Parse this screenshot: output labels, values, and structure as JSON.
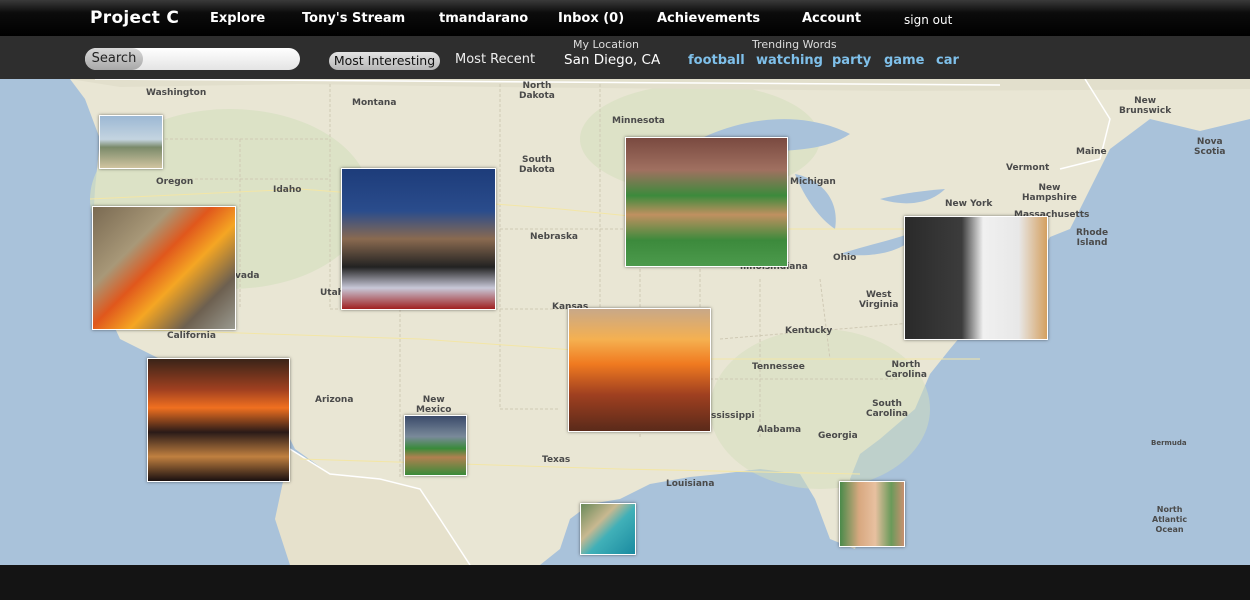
{
  "app": {
    "title": "Project C",
    "nav": [
      "Explore",
      "Tony's Stream",
      "tmandarano",
      "Inbox (0)",
      "Achievements",
      "Account"
    ],
    "signout": "sign out"
  },
  "search": {
    "button_label": "Search",
    "value": "",
    "placeholder": ""
  },
  "sort_tabs": {
    "active": "Most Interesting",
    "other": "Most Recent"
  },
  "location": {
    "label": "My Location",
    "value": "San Diego, CA"
  },
  "trending": {
    "label": "Trending Words",
    "words": [
      "football",
      "watching",
      "party",
      "game",
      "car"
    ]
  },
  "map_labels": {
    "washington": "Washington",
    "montana": "Montana",
    "north_dakota": "North\nDakota",
    "minnesota": "Minnesota",
    "south_dakota": "South\nDakota",
    "oregon": "Oregon",
    "idaho": "Idaho",
    "nebraska": "Nebraska",
    "michigan": "Michigan",
    "new_york": "New York",
    "vermont": "Vermont",
    "new_hampshire": "New\nHampshire",
    "massachusetts": "Massachusetts",
    "rhode_island": "Rhode\nIsland",
    "maine": "Maine",
    "new_brunswick": "New\nBrunswick",
    "nova_scotia": "Nova\nScotia",
    "nevada": "vada",
    "utah": "Utah",
    "kansas": "Kansas",
    "illinois": "llinois",
    "indiana": "Indiana",
    "ohio": "Ohio",
    "west_virginia": "West\nVirginia",
    "kentucky": "Kentucky",
    "california": "California",
    "tennessee": "Tennessee",
    "north_carolina": "North\nCarolina",
    "arizona": "Arizona",
    "new_mexico": "New\nMexico",
    "mississippi": "ssissippi",
    "south_carolina": "South\nCarolina",
    "alabama": "Alabama",
    "georgia": "Georgia",
    "texas": "Texas",
    "louisiana": "Louisiana",
    "bermuda": "Bermuda",
    "north_atlantic": "North\nAtlantic\nOcean"
  },
  "photos": [
    {
      "name": "coastline-photo",
      "bg": "linear-gradient(#9cb8d4 0%, #c4d4e0 45%, #7a8a6a 60%, #d0c4a0 100%)"
    },
    {
      "name": "burning-sports-car-photo",
      "bg": "linear-gradient(135deg,#7a6a52 0%,#a89878 30%,#e0571c 45%,#f5a623 60%,#6d6050 80%,#9a9a90 100%)"
    },
    {
      "name": "political-rally-photo",
      "bg": "linear-gradient(#1d3c7a 0%,#2a4c8c 30%,#8a6a50 50%,#222 70%,#c8c8d8 85%,#a02020 100%)"
    },
    {
      "name": "baseball-stadium-photo",
      "bg": "linear-gradient(#7a4a40 0%,#a07060 25%,#3c8a3c 45%,#c09060 60%,#3c8a3c 80%,#4c9a4c 100%)"
    },
    {
      "name": "celebrities-photo",
      "bg": "linear-gradient(90deg,#2a2a2a 0%,#3c3c3c 40%,#f0f0f0 55%,#e8e8e8 80%,#d4a060 100%)"
    },
    {
      "name": "building-fire-photo",
      "bg": "linear-gradient(#c8a888 0%,#f5b050 25%,#f07a20 45%,#a04020 70%,#5a2a1a 100%)"
    },
    {
      "name": "wildfire-city-photo",
      "bg": "linear-gradient(#3a2418 0%,#a04020 25%,#f07020 40%,#2a1a18 60%,#c08040 80%,#1a1010 100%)"
    },
    {
      "name": "baseball-field-photo",
      "bg": "linear-gradient(#3a4a6a 0%,#7a8a9a 35%,#3a8a3a 55%,#b08050 70%,#3a8a3a 100%)"
    },
    {
      "name": "beach-aerial-photo",
      "bg": "linear-gradient(135deg,#6a8a5a 0%,#c8b890 35%,#40b0b8 55%,#1a8aa0 100%)"
    },
    {
      "name": "beach-party-photo",
      "bg": "linear-gradient(90deg,#4a8a4a 0%,#d8a880 30%,#e8c0a0 55%,#6a9a5a 80%,#c89070 100%)"
    }
  ]
}
